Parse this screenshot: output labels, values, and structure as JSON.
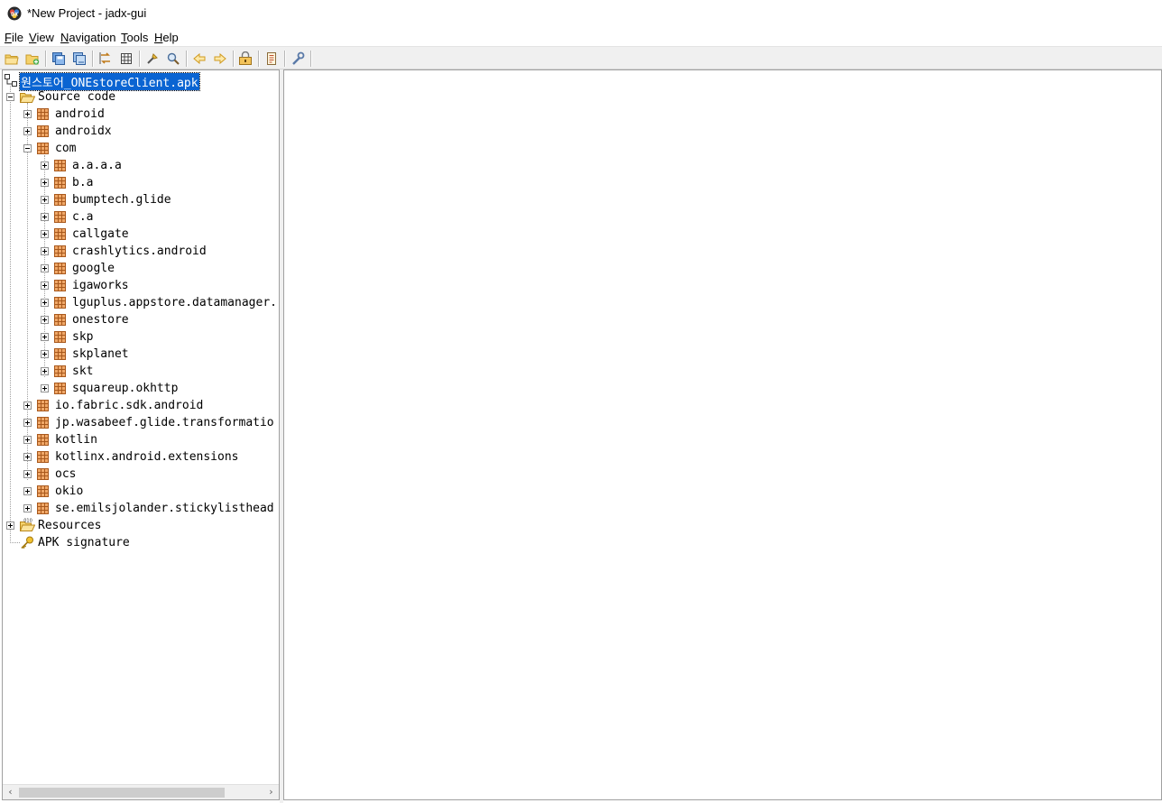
{
  "window": {
    "title": "*New Project - jadx-gui",
    "icon": "jadx-logo-icon"
  },
  "menu": [
    {
      "mn": "F",
      "rest": "ile"
    },
    {
      "mn": "V",
      "rest": "iew"
    },
    {
      "mn": "N",
      "rest": "avigation"
    },
    {
      "mn": "T",
      "rest": "ools"
    },
    {
      "mn": "H",
      "rest": "elp"
    }
  ],
  "toolbar": {
    "buttons": [
      "open-file-icon",
      "add-files-icon",
      "save-all-icon",
      "export-icon",
      "sync-tree-icon",
      "flatten-packages-icon",
      "text-search-icon",
      "class-search-icon",
      "back-icon",
      "forward-icon",
      "deobfuscation-icon",
      "log-viewer-icon",
      "preferences-icon"
    ]
  },
  "tree": {
    "root": "원스토어_ONEstoreClient.apk",
    "source_code": "Source code",
    "packages_top": [
      "android",
      "androidx",
      "com"
    ],
    "packages_com": [
      "a.a.a.a",
      "b.a",
      "bumptech.glide",
      "c.a",
      "callgate",
      "crashlytics.android",
      "google",
      "igaworks",
      "lguplus.appstore.datamanager.",
      "onestore",
      "skp",
      "skplanet",
      "skt",
      "squareup.okhttp"
    ],
    "packages_bottom": [
      "io.fabric.sdk.android",
      "jp.wasabeef.glide.transformatio",
      "kotlin",
      "kotlinx.android.extensions",
      "ocs",
      "okio",
      "se.emilsjolander.stickylisthead"
    ],
    "resources": "Resources",
    "apk_signature": "APK signature"
  },
  "colors": {
    "selection": "#0a64d2",
    "toolbar_bg": "#f0f0f0",
    "package_icon": "#c8782d"
  }
}
